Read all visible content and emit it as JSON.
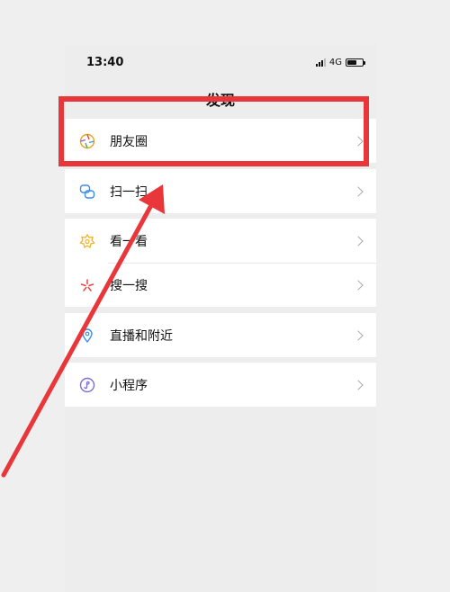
{
  "status_bar": {
    "time": "13:40",
    "network": "4G",
    "battery_level": 0.6
  },
  "nav": {
    "title": "发现"
  },
  "menu": {
    "moments": "朋友圈",
    "scan": "扫一扫",
    "top_stories": "看一看",
    "search": "搜一搜",
    "live_nearby": "直播和附近",
    "mini_programs": "小程序"
  },
  "colors": {
    "highlight": "#e8363a",
    "background": "#ededed",
    "row_background": "#ffffff"
  },
  "icons": [
    "moments-icon",
    "scan-icon",
    "top-stories-icon",
    "search-icon",
    "live-nearby-icon",
    "mini-program-icon",
    "chevron-right-icon"
  ]
}
